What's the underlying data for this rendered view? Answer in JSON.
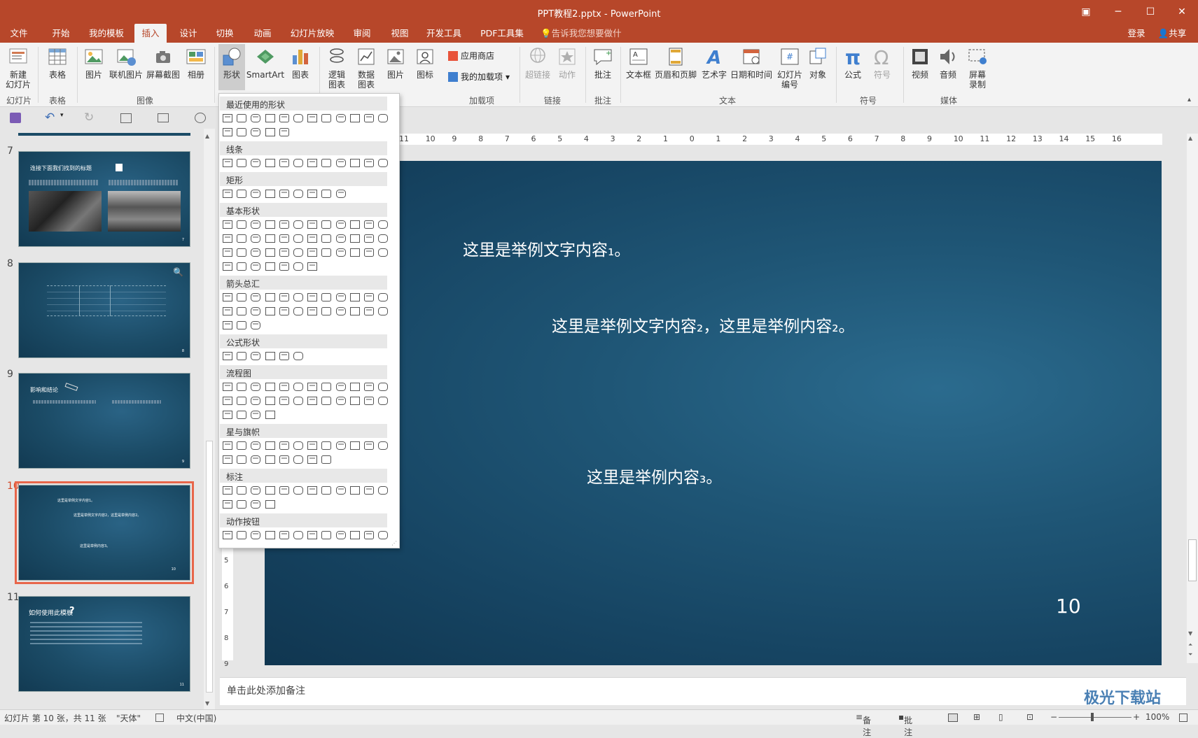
{
  "window": {
    "title": "PPT教程2.pptx - PowerPoint"
  },
  "tabs": [
    "文件",
    "开始",
    "我的模板",
    "插入",
    "设计",
    "切换",
    "动画",
    "幻灯片放映",
    "审阅",
    "视图",
    "开发工具",
    "PDF工具集"
  ],
  "active_tab": "插入",
  "tell_me": "告诉我您想要做什么...",
  "account": {
    "login": "登录",
    "share": "共享"
  },
  "ribbon": {
    "slides": {
      "new_slide": "新建\n幻灯片",
      "group": "幻灯片"
    },
    "table": {
      "table": "表格",
      "group": "表格"
    },
    "images": {
      "picture": "图片",
      "online_picture": "联机图片",
      "screenshot": "屏幕截图",
      "album": "相册",
      "group": "图像"
    },
    "illustrations": {
      "shapes": "形状",
      "smartart": "SmartArt",
      "chart": "图表"
    },
    "addins_left": {
      "logic_chart": "逻辑\n图表",
      "data_chart": "数据\n图表",
      "picture": "图片",
      "icon": "图标"
    },
    "addins": {
      "store": "应用商店",
      "my_addins": "我的加载项",
      "group": "加载项"
    },
    "links": {
      "hyperlink": "超链接",
      "action": "动作",
      "group": "链接"
    },
    "comments": {
      "comment": "批注",
      "group": "批注"
    },
    "text": {
      "textbox": "文本框",
      "header_footer": "页眉和页脚",
      "wordart": "艺术字",
      "datetime": "日期和时间",
      "slide_number": "幻灯片\n编号",
      "object": "对象",
      "group": "文本"
    },
    "symbols": {
      "equation": "公式",
      "symbol": "符号",
      "group": "符号"
    },
    "media": {
      "video": "视频",
      "audio": "音频",
      "screen_record": "屏幕\n录制",
      "group": "媒体"
    }
  },
  "shapes_menu": {
    "sections": [
      {
        "title": "最近使用的形状",
        "rows": [
          12,
          5
        ]
      },
      {
        "title": "线条",
        "rows": [
          12
        ]
      },
      {
        "title": "矩形",
        "rows": [
          9
        ]
      },
      {
        "title": "基本形状",
        "rows": [
          12,
          12,
          12,
          7
        ]
      },
      {
        "title": "箭头总汇",
        "rows": [
          12,
          12,
          3
        ]
      },
      {
        "title": "公式形状",
        "rows": [
          6
        ]
      },
      {
        "title": "流程图",
        "rows": [
          12,
          12,
          4
        ]
      },
      {
        "title": "星与旗帜",
        "rows": [
          12,
          8
        ]
      },
      {
        "title": "标注",
        "rows": [
          12,
          4
        ]
      },
      {
        "title": "动作按钮",
        "rows": [
          12
        ]
      }
    ]
  },
  "ruler": {
    "h_ticks": [
      "11",
      "10",
      "9",
      "8",
      "7",
      "6",
      "5",
      "4",
      "3",
      "2",
      "1",
      "0",
      "1",
      "2",
      "3",
      "4",
      "5",
      "6",
      "7",
      "8",
      "9",
      "10",
      "11",
      "12",
      "13",
      "14",
      "15",
      "16"
    ],
    "v_ticks": [
      "5",
      "6",
      "7",
      "8",
      "9"
    ]
  },
  "slides": [
    {
      "number": "7",
      "title": "连接下面我们找到的标题",
      "page": "7"
    },
    {
      "number": "8",
      "page": "8"
    },
    {
      "number": "9",
      "title": "影响和结论",
      "page": "9"
    },
    {
      "number": "10",
      "page": "10",
      "selected": true,
      "lines": [
        "这里是举例文字内容1。",
        "这里是举例文字内容2，这里是举例内容2。",
        "这里是举例内容3。"
      ]
    },
    {
      "number": "11",
      "title": "如何使用此模板",
      "page": "11"
    }
  ],
  "current_slide": {
    "text1": "这里是举例文字内容₁。",
    "text2": "这里是举例文字内容₂，这里是举例内容₂。",
    "text3": "这里是举例内容₃。",
    "page_number": "10"
  },
  "notes_placeholder": "单击此处添加备注",
  "status": {
    "slide_info": "幻灯片 第 10 张，共 11 张",
    "theme": "\"天体\"",
    "language": "中文(中国)",
    "notes": "备注",
    "comments": "批注",
    "zoom": "100%"
  },
  "watermark": "极光下载站"
}
